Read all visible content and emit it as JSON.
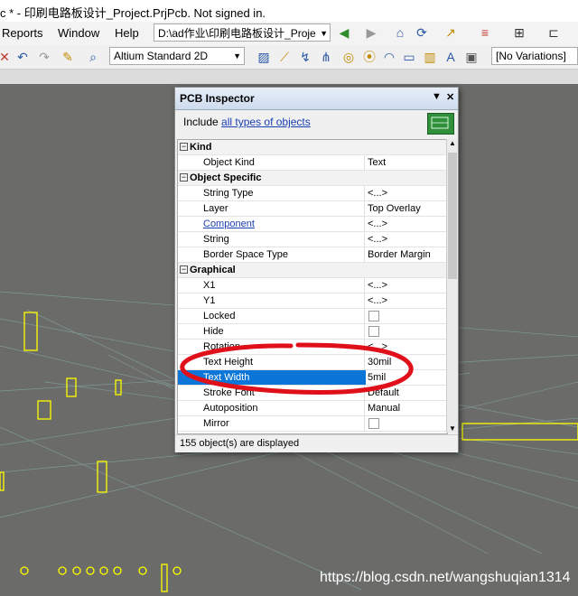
{
  "title": "c * - 印刷电路板设计_Project.PrjPcb. Not signed in.",
  "menu": [
    "Reports",
    "Window",
    "Help"
  ],
  "path": "D:\\ad作业\\印刷电路板设计_Proje",
  "toolbar": {
    "view_mode": "Altium Standard 2D",
    "variations": "[No Variations]"
  },
  "inspector": {
    "title": "PCB Inspector",
    "include_label": "Include",
    "include_link": "all types of objects",
    "status": "155 object(s) are displayed",
    "rows": [
      {
        "cat": "Kind"
      },
      {
        "k": "Object Kind",
        "v": "Text"
      },
      {
        "cat": "Object Specific"
      },
      {
        "k": "String Type",
        "v": "<...>"
      },
      {
        "k": "Layer",
        "v": "Top Overlay"
      },
      {
        "k": "Component",
        "v": "<...>",
        "link": true
      },
      {
        "k": "String",
        "v": "<...>"
      },
      {
        "k": "Border Space Type",
        "v": "Border Margin"
      },
      {
        "cat": "Graphical"
      },
      {
        "k": "X1",
        "v": "<...>"
      },
      {
        "k": "Y1",
        "v": "<...>"
      },
      {
        "k": "Locked",
        "check": true
      },
      {
        "k": "Hide",
        "check": true
      },
      {
        "k": "Rotation",
        "v": "<...>"
      },
      {
        "k": "Text Height",
        "v": "30mil"
      },
      {
        "k": "Text Width",
        "v": "5mil",
        "selected": true
      },
      {
        "k": "Stroke Font",
        "v": "Default"
      },
      {
        "k": "Autoposition",
        "v": "Manual"
      },
      {
        "k": "Mirror",
        "check": true
      }
    ]
  },
  "watermark": "https://blog.csdn.net/wangshuqian1314",
  "colors": {
    "accent": "#0b76d8",
    "annotation": "#e0101a",
    "component": "#ffff00",
    "canvas": "#6b6b69"
  }
}
